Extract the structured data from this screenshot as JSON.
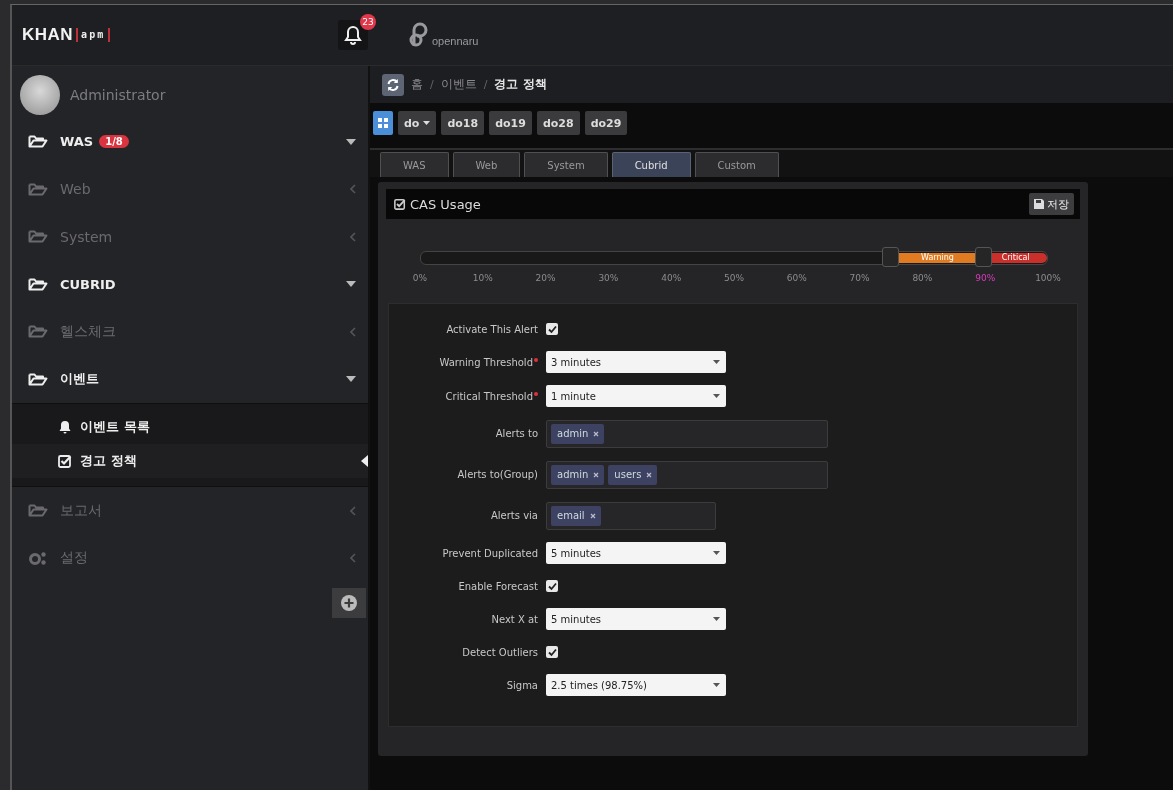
{
  "topbar": {
    "logo": {
      "name": "KHAN",
      "suffix": "apm"
    },
    "notifications": {
      "count": "23"
    },
    "brand": "opennaru"
  },
  "sidebar": {
    "user": "Administrator",
    "items": [
      {
        "kind": "folder",
        "label": "WAS",
        "badge": "1/8",
        "expanded": true
      },
      {
        "kind": "folder",
        "label": "Web",
        "expanded": false
      },
      {
        "kind": "folder",
        "label": "System",
        "expanded": false
      },
      {
        "kind": "folder",
        "label": "CUBRID",
        "expanded": true
      },
      {
        "kind": "folder",
        "label": "헬스체크",
        "expanded": false
      },
      {
        "kind": "folder",
        "label": "이벤트",
        "expanded": true,
        "children": [
          {
            "kind": "bell",
            "label": "이벤트 목록",
            "selected": false
          },
          {
            "kind": "check",
            "label": "경고 정책",
            "selected": true
          }
        ]
      },
      {
        "kind": "folder",
        "label": "보고서",
        "expanded": false
      },
      {
        "kind": "gear",
        "label": "설정",
        "expanded": false
      }
    ]
  },
  "breadcrumb": {
    "separator": "/",
    "items": [
      {
        "label": "홈",
        "current": false
      },
      {
        "label": "이벤트",
        "current": false
      },
      {
        "label": "경고 정책",
        "current": true
      }
    ]
  },
  "toolbar": {
    "dropdown": "do",
    "servers": [
      "do18",
      "do19",
      "do28",
      "do29"
    ]
  },
  "tabs": [
    {
      "label": "WAS",
      "selected": false
    },
    {
      "label": "Web",
      "selected": false
    },
    {
      "label": "System",
      "selected": false
    },
    {
      "label": "Cubrid",
      "selected": true
    },
    {
      "label": "Custom",
      "selected": false
    }
  ],
  "panel": {
    "title": "CAS Usage",
    "save": "저장",
    "slider": {
      "handles": [
        {
          "label": "Warning",
          "level": 0.75,
          "color": "#e07b22"
        },
        {
          "label": "Critical",
          "level": 0.9,
          "color": "#c9302c"
        }
      ],
      "ticks": [
        {
          "label": "0%",
          "selected": false
        },
        {
          "label": "10%",
          "selected": false
        },
        {
          "label": "20%",
          "selected": false
        },
        {
          "label": "30%",
          "selected": false
        },
        {
          "label": "40%",
          "selected": false
        },
        {
          "label": "50%",
          "selected": false
        },
        {
          "label": "60%",
          "selected": false
        },
        {
          "label": "70%",
          "selected": false
        },
        {
          "label": "80%",
          "selected": false
        },
        {
          "label": "90%",
          "selected": true
        },
        {
          "label": "100%",
          "selected": false
        }
      ]
    },
    "fields": [
      {
        "kind": "checkbox",
        "label": "Activate This Alert",
        "checked": true
      },
      {
        "kind": "select",
        "label": "Warning Threshold",
        "required": true,
        "value": "3 minutes"
      },
      {
        "kind": "select",
        "label": "Critical Threshold",
        "required": true,
        "value": "1 minute"
      },
      {
        "kind": "tags",
        "label": "Alerts to",
        "wide": true,
        "tags": [
          "admin"
        ]
      },
      {
        "kind": "tags",
        "label": "Alerts to(Group)",
        "wide": true,
        "tags": [
          "admin",
          "users"
        ]
      },
      {
        "kind": "tags",
        "label": "Alerts via",
        "wide": false,
        "tags": [
          "email"
        ]
      },
      {
        "kind": "select",
        "label": "Prevent Duplicated",
        "required": false,
        "value": "5 minutes"
      },
      {
        "kind": "checkbox",
        "label": "Enable Forecast",
        "checked": true
      },
      {
        "kind": "select",
        "label": "Next X at",
        "required": false,
        "value": "5 minutes"
      },
      {
        "kind": "checkbox",
        "label": "Detect Outliers",
        "checked": true
      },
      {
        "kind": "select",
        "label": "Sigma",
        "required": false,
        "value": "2.5 times (98.75%)"
      }
    ]
  }
}
